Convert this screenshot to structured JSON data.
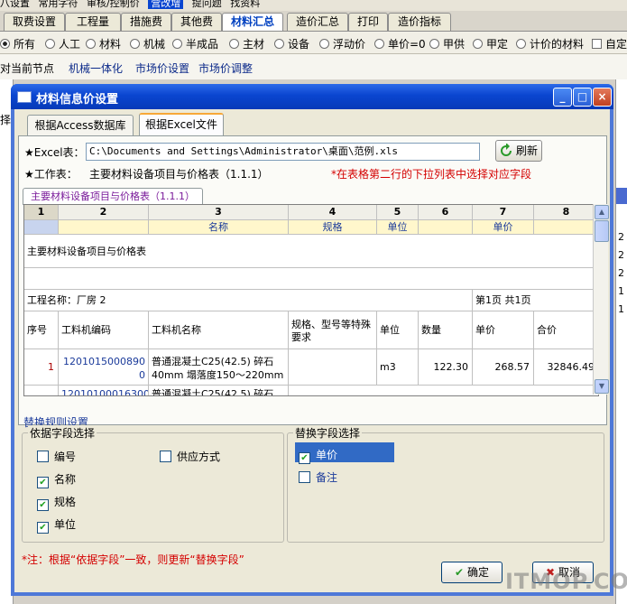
{
  "app": {
    "top_strip": [
      "八设置",
      "常用字符",
      "审核/控制价",
      "营改增",
      "提问题",
      "找资料"
    ],
    "tabs": [
      "取费设置",
      "工程量",
      "措施费",
      "其他费",
      "材料汇总",
      "造价汇总",
      "打印",
      "造价指标"
    ],
    "active_tab": "材料汇总",
    "filters": [
      "所有",
      "人工",
      "材料",
      "机械",
      "半成品",
      "主材",
      "设备",
      "浮动价",
      "单价=0",
      "甲供",
      "甲定",
      "计价的材料",
      "自定"
    ],
    "nav": [
      "对当前节点",
      "机械一体化",
      "市场价设置",
      "市场价调整"
    ],
    "left_fragment": "择",
    "right_numbers": [
      "2",
      "2",
      "2",
      "1",
      "1"
    ]
  },
  "dialog": {
    "title": "材料信息价设置",
    "buttons": {
      "minimize": "_",
      "maximize": "□",
      "close": "×"
    },
    "tabs": [
      "根据Access数据库",
      "根据Excel文件"
    ],
    "active_tab": "根据Excel文件",
    "excel_label": "★Excel表：",
    "excel_path": "C:\\Documents and Settings\\Administrator\\桌面\\范例.xls",
    "refresh_label": "刷新",
    "sheet_label": "★工作表：",
    "sheet_value": "主要材料设备项目与价格表（1.1.1）",
    "hint": "*在表格第二行的下拉列表中选择对应字段",
    "sheet_tab": "主要材料设备项目与价格表（1.1.1）",
    "grid": {
      "col_headers": [
        "1",
        "2",
        "3",
        "4",
        "5",
        "6",
        "7",
        "8"
      ],
      "field_row": [
        "",
        "",
        "名称",
        "规格",
        "单位",
        "",
        "单价",
        ""
      ],
      "title_row": "主要材料设备项目与价格表",
      "project_row": "工程名称：厂房 2",
      "page_row": "第1页 共1页",
      "header_row": [
        "序号",
        "工料机编码",
        "工料机名称",
        "规格、型号等特殊要求",
        "单位",
        "数量",
        "单价",
        "合价"
      ],
      "data_row": [
        "1",
        "12010150008900",
        "普通混凝土C25(42.5) 碎石40mm 塌落度150～220mm",
        "",
        "m3",
        "122.30",
        "268.57",
        "32846.49"
      ],
      "partial_row": [
        "",
        "12010100016300",
        "普通混凝土C25(42.5) 碎石",
        "",
        "",
        "",
        "",
        ""
      ]
    },
    "rules_title": "替换规则设置",
    "basis_title": "依据字段选择",
    "basis_items": [
      {
        "label": "编号",
        "checked": false
      },
      {
        "label": "供应方式",
        "checked": false
      },
      {
        "label": "名称",
        "checked": true
      },
      {
        "label": "规格",
        "checked": true
      },
      {
        "label": "单位",
        "checked": true
      }
    ],
    "replace_title": "替换字段选择",
    "replace_items": [
      {
        "label": "单价",
        "checked": true,
        "selected": true
      },
      {
        "label": "备注",
        "checked": false,
        "selected": false
      }
    ],
    "note": "*注：根据“依据字段”一致，则更新“替换字段”",
    "ok_label": "确定",
    "cancel_label": "取消"
  },
  "watermark": "ITMOP.COM",
  "colors": {
    "accent": "#0a45d0",
    "hint": "#d40000",
    "selection": "#316ac5",
    "field_row": "#fff7cc"
  }
}
